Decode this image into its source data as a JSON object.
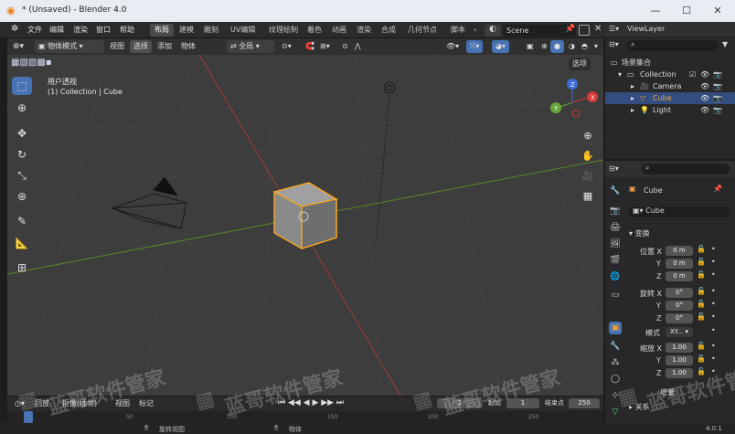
{
  "window": {
    "title": "* (Unsaved) - Blender 4.0",
    "minimize": "—",
    "maximize": "☐",
    "close": "✕"
  },
  "menu": [
    "文件",
    "编辑",
    "渲染",
    "窗口",
    "帮助"
  ],
  "workspaces": [
    "布局",
    "建模",
    "雕刻",
    "UV编辑",
    "纹理绘制",
    "着色",
    "动画",
    "渲染",
    "合成",
    "几何节点",
    "脚本"
  ],
  "workspaces_more": "‹",
  "scene": {
    "name": "Scene"
  },
  "view_layer": {
    "name": "ViewLayer"
  },
  "viewport_header": {
    "mode": "物体模式",
    "view": "视图",
    "select": "选择",
    "add": "添加",
    "object": "物体",
    "transform": "全局",
    "options": "选项"
  },
  "viewport": {
    "view_name": "用户透视",
    "collection_line": "(1) Collection | Cube"
  },
  "gizmo": {
    "x": "X",
    "y": "Y",
    "z": "Z"
  },
  "outliner": {
    "root": "场景集合",
    "items": [
      {
        "name": "Collection",
        "icon": "collection-icon"
      },
      {
        "name": "Camera",
        "icon": "camera-icon"
      },
      {
        "name": "Cube",
        "icon": "mesh-icon"
      },
      {
        "name": "Light",
        "icon": "light-icon"
      }
    ]
  },
  "properties": {
    "object_name": "Cube",
    "data_name": "Cube",
    "transform_title": "变换",
    "location_label": "位置 X",
    "rotation_label": "旋转 X",
    "scale_label": "缩放 X",
    "axis_y": "Y",
    "axis_z": "Z",
    "loc": [
      "0 m",
      "0 m",
      "0 m"
    ],
    "rot": [
      "0°",
      "0°",
      "0°"
    ],
    "mode_label": "模式",
    "mode_value": "XY...",
    "scale": [
      "1.00",
      "1.00",
      "1.00"
    ],
    "delta_title": "增量",
    "relations_title": "关系"
  },
  "timeline": {
    "playback": "回放",
    "keying": "抠像(插帧)",
    "view": "视图",
    "marker": "标记",
    "current_frame": "1",
    "start_label": "起始",
    "start": "1",
    "end_label": "结束点",
    "end": "250"
  },
  "timeline_ruler": [
    "0",
    "50",
    "100",
    "150",
    "200",
    "250"
  ],
  "status": {
    "left": "旋转视图",
    "mid": "物体",
    "version": "4.0.1"
  },
  "watermark": "蓝哥软件管家"
}
